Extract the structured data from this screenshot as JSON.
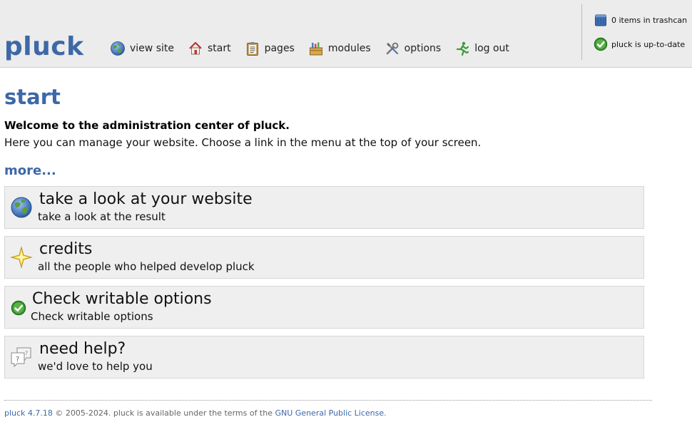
{
  "header": {
    "logo": "pluck",
    "nav": [
      {
        "label": "view site",
        "icon": "globe-icon"
      },
      {
        "label": "start",
        "icon": "home-icon"
      },
      {
        "label": "pages",
        "icon": "clipboard-icon"
      },
      {
        "label": "modules",
        "icon": "toolbox-icon"
      },
      {
        "label": "options",
        "icon": "tools-icon"
      },
      {
        "label": "log out",
        "icon": "running-man-icon"
      }
    ],
    "status": {
      "trash": "0 items in trashcan",
      "uptodate": "pluck is up-to-date"
    }
  },
  "main": {
    "title": "start",
    "welcome": "Welcome to the administration center of pluck.",
    "intro": "Here you can manage your website. Choose a link in the menu at the top of your screen.",
    "more": "more...",
    "boxes": [
      {
        "title": "take a look at your website",
        "subtitle": "take a look at the result",
        "icon": "globe-icon"
      },
      {
        "title": "credits",
        "subtitle": "all the people who helped develop pluck",
        "icon": "star-icon"
      },
      {
        "title": "Check writable options",
        "subtitle": "Check writable options",
        "icon": "check-icon"
      },
      {
        "title": "need help?",
        "subtitle": "we'd love to help you",
        "icon": "help-bubbles-icon"
      }
    ]
  },
  "footer": {
    "version_link": "pluck 4.7.18",
    "copyright": " © 2005-2024. pluck is available under the terms of the ",
    "license_link": "GNU General Public License",
    "end": "."
  },
  "colors": {
    "brand_blue": "#3d68a8",
    "header_bg": "#ececec",
    "box_bg": "#efefef"
  }
}
